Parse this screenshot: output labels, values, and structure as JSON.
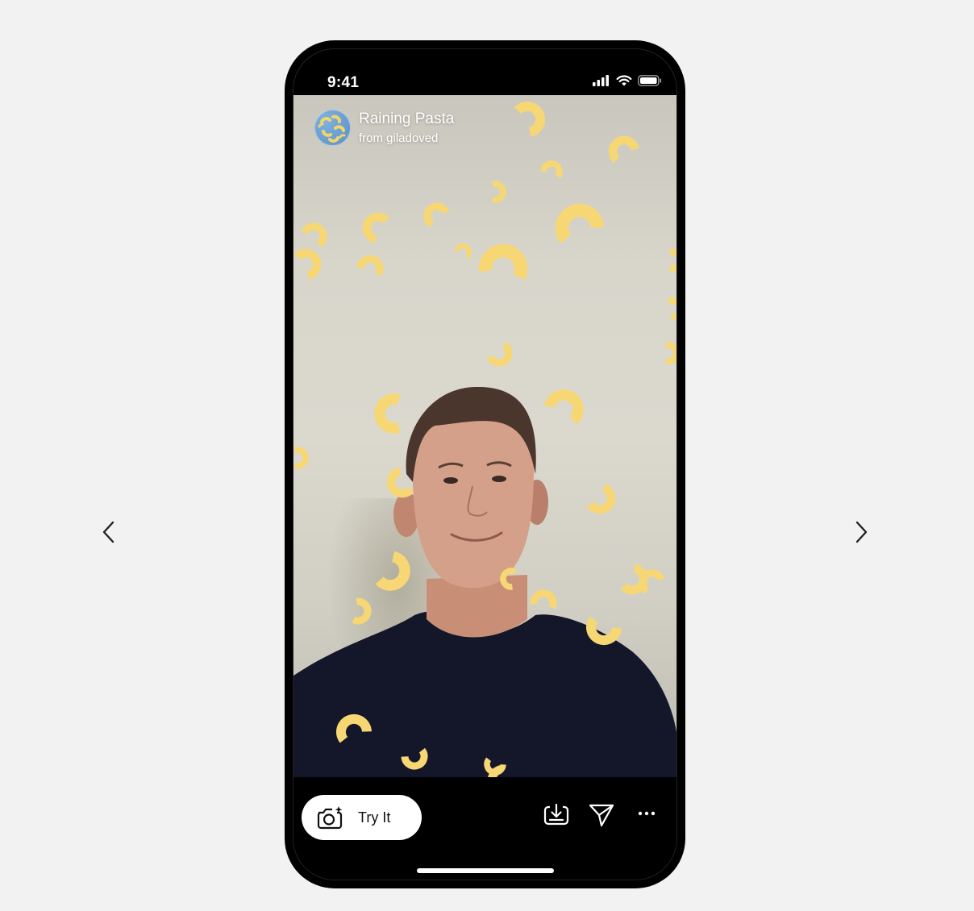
{
  "status_bar": {
    "time": "9:41"
  },
  "effect": {
    "title": "Raining Pasta",
    "author": "from giladoved"
  },
  "actions": {
    "try_label": "Try It"
  },
  "icons": {
    "prev": "chevron-left-icon",
    "next": "chevron-right-icon",
    "camera": "camera-sparkle-icon",
    "save": "save-download-icon",
    "share": "send-icon",
    "more": "more-horizontal-icon"
  },
  "colors": {
    "pasta": "#f7d774",
    "background": "#f2f2f2",
    "phone": "#000000"
  }
}
